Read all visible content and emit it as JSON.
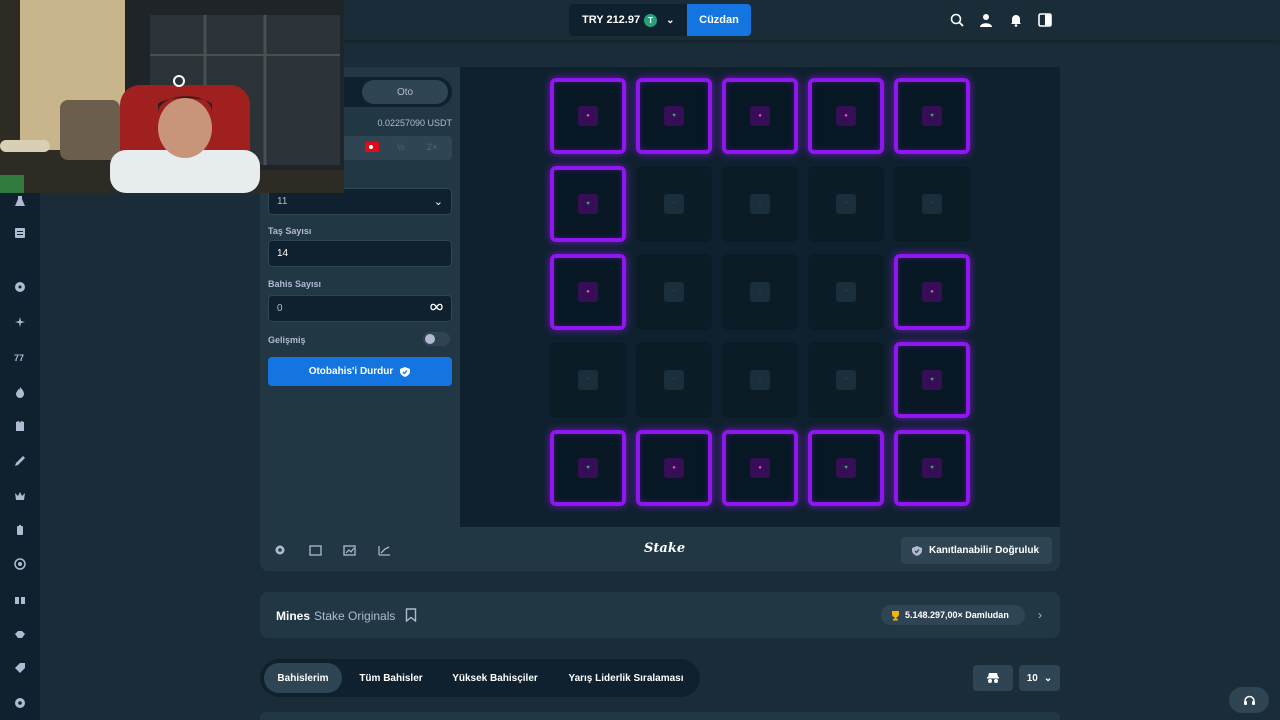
{
  "header": {
    "balance": "TRY 212.97",
    "coin_symbol": "T",
    "wallet_label": "Cüzdan",
    "icons": [
      "search-icon",
      "user-icon",
      "bell-icon",
      "sidebar-toggle-icon"
    ]
  },
  "controls": {
    "tab_auto": "Oto",
    "usdt_value": "0.02257090 USDT",
    "half_label": "½",
    "double_label": "2×",
    "mines_value": "11",
    "gems_label": "Taş Sayısı",
    "gems_value": "14",
    "bets_label": "Bahis Sayısı",
    "bets_value": "0",
    "advanced_label": "Gelişmiş",
    "stop_button": "Otobahis'i Durdur"
  },
  "board": {
    "size": 5,
    "tiles": [
      "mine",
      "gem",
      "mine",
      "mine",
      "gem",
      "gem",
      "hidden",
      "hidden",
      "hidden",
      "hidden",
      "mine",
      "hidden",
      "hidden",
      "hidden",
      "mine",
      "hidden",
      "hidden",
      "hidden",
      "hidden",
      "gem",
      "gem",
      "mine",
      "mine",
      "gem",
      "gem"
    ],
    "colors": {
      "revealed_border": "#8d17ec",
      "mine": "#ff3ce0",
      "gem": "#3aa37b"
    }
  },
  "footer": {
    "logo": "Stake",
    "fairness_button": "Kanıtlanabilir Doğruluk"
  },
  "info": {
    "game_title": "Mines",
    "provider": "Stake Originals",
    "prize_text": "5.148.297,00× Damludan"
  },
  "bets": {
    "tabs": [
      "Bahislerim",
      "Tüm Bahisler",
      "Yüksek Bahisçiler",
      "Yarış Liderlik Sıralaması"
    ],
    "count": "10"
  },
  "colors": {
    "background": "#1a2c38",
    "panel": "#213743",
    "dark": "#0f212e",
    "accent": "#1475e1"
  }
}
